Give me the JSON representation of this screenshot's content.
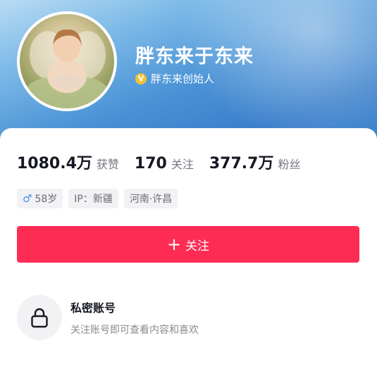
{
  "profile": {
    "name": "胖东来于东来",
    "verification": "胖东来创始人",
    "verify_icon": "V"
  },
  "stats": [
    {
      "value": "1080.4万",
      "label": "获赞"
    },
    {
      "value": "170",
      "label": "关注"
    },
    {
      "value": "377.7万",
      "label": "粉丝"
    }
  ],
  "tags": {
    "gender_symbol": "♂",
    "age": "58岁",
    "ip": "IP：新疆",
    "location": "河南·许昌"
  },
  "follow_button": {
    "icon": "+",
    "label": "关注"
  },
  "private_account": {
    "title": "私密账号",
    "description": "关注账号即可查看内容和喜欢"
  },
  "colors": {
    "accent": "#fe2c55",
    "hero_blue": "#3b7fcb",
    "verify_gold": "#f2c234"
  }
}
